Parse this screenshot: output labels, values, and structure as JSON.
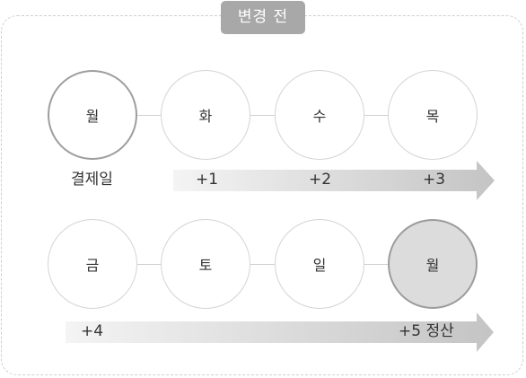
{
  "title": "변경 전",
  "row1": {
    "days": [
      "월",
      "화",
      "수",
      "목"
    ],
    "start_label": "결제일",
    "offsets": [
      "+1",
      "+2",
      "+3"
    ]
  },
  "row2": {
    "days": [
      "금",
      "토",
      "일",
      "월"
    ],
    "offsets": [
      "+4"
    ],
    "end_label": "+5 정산"
  }
}
